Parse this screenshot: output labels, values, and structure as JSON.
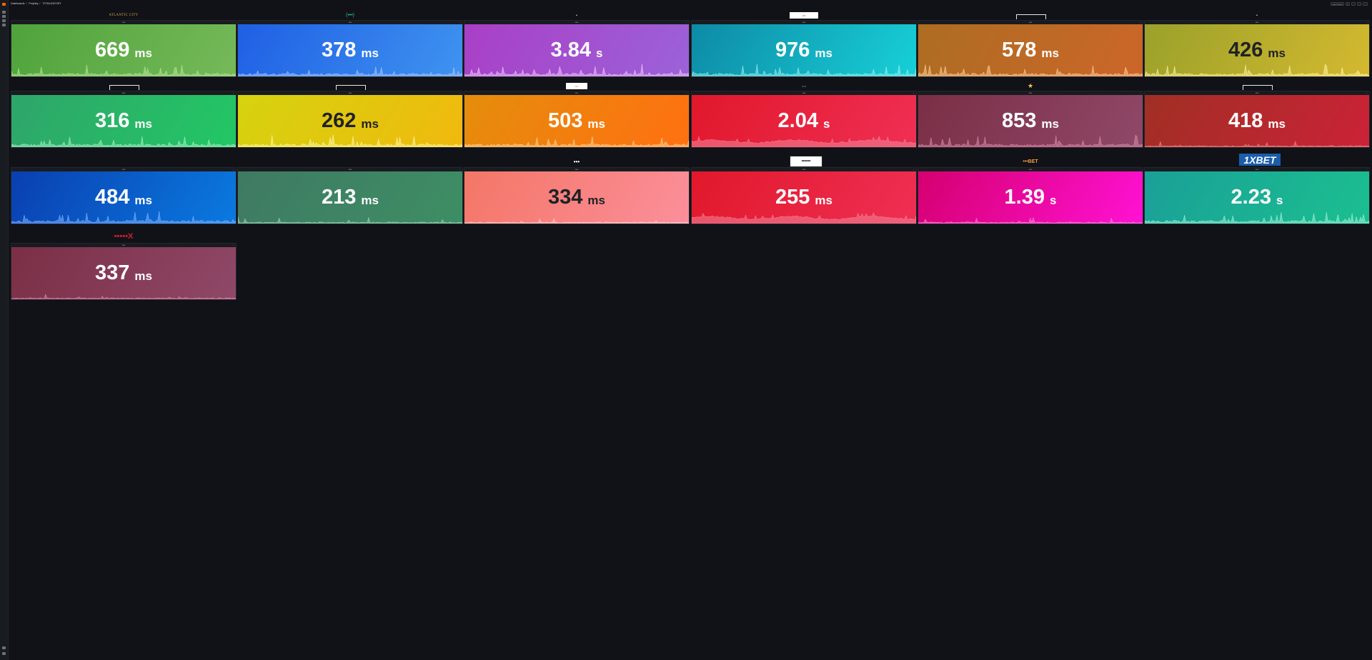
{
  "header": {
    "breadcrumb": [
      "Dashboards",
      "Projekty",
      "TOTALIZATORY"
    ],
    "time_picker": "Last 6 hours",
    "controls": [
      "↺",
      "−",
      "⬚",
      "⋮"
    ]
  },
  "sidebar": {
    "icons": [
      "grafana-logo-icon",
      "search-icon",
      "starred-icon",
      "dashboards-icon",
      "explore-icon",
      "alerting-icon",
      "help-icon"
    ]
  },
  "panels": [
    {
      "logo": "ATLANTIC CITY",
      "logo_style": "l-gold",
      "title": "•••••",
      "value": "669",
      "unit": "ms",
      "gradient": [
        "#4fa33b",
        "#76b95a"
      ],
      "text_theme": "light",
      "spark_color": "#b7e59a",
      "spark_type": "spiky"
    },
    {
      "logo": "(•••)",
      "logo_style": "l-hw",
      "title": "•••••",
      "value": "378",
      "unit": "ms",
      "gradient": [
        "#1f5fe4",
        "#3f93f0"
      ],
      "text_theme": "light",
      "spark_color": "#a8c8ff",
      "spark_type": "spiky"
    },
    {
      "logo": "•",
      "logo_style": "l-dot",
      "title": "•••••",
      "value": "3.84",
      "unit": "s",
      "gradient": [
        "#a93fc6",
        "#9b62d8"
      ],
      "text_theme": "light",
      "spark_color": "#f0c6ff",
      "spark_type": "spiky"
    },
    {
      "logo": "••••",
      "logo_style": "l-whitebox",
      "title": "•••••",
      "value": "976",
      "unit": "ms",
      "gradient": [
        "#0e8aa6",
        "#17d0d7"
      ],
      "text_theme": "light",
      "spark_color": "#9beeed",
      "spark_type": "spiky"
    },
    {
      "logo": "",
      "logo_style": "l-bracket",
      "title": "•••••",
      "value": "578",
      "unit": "ms",
      "gradient": [
        "#ad6d22",
        "#cc6629"
      ],
      "text_theme": "light",
      "spark_color": "#ffd09a",
      "spark_type": "spiky"
    },
    {
      "logo": "•",
      "logo_style": "l-dot",
      "title": "•••••",
      "value": "426",
      "unit": "ms",
      "gradient": [
        "#9aa12a",
        "#d5b930"
      ],
      "text_theme": "dark",
      "spark_color": "#fff4a0",
      "spark_type": "spiky"
    },
    {
      "logo": "",
      "logo_style": "l-bracket",
      "title": "•••••",
      "value": "316",
      "unit": "ms",
      "gradient": [
        "#2fa56a",
        "#22c764"
      ],
      "text_theme": "light",
      "spark_color": "#a6f0c6",
      "spark_type": "spiky"
    },
    {
      "logo": "",
      "logo_style": "l-bracket",
      "title": "•••••",
      "value": "262",
      "unit": "ms",
      "gradient": [
        "#d5d30f",
        "#f0b90e"
      ],
      "text_theme": "dark",
      "spark_color": "#fff7a0",
      "spark_type": "spiky"
    },
    {
      "logo": "••••",
      "logo_style": "l-orangebox",
      "title": "•••••",
      "value": "503",
      "unit": "ms",
      "gradient": [
        "#e58d0c",
        "#ff7011"
      ],
      "text_theme": "light",
      "spark_color": "#ffd39a",
      "spark_type": "spiky"
    },
    {
      "logo": "•••••",
      "logo_style": "l-small",
      "title": "•••••",
      "value": "2.04",
      "unit": "s",
      "gradient": [
        "#e1182b",
        "#ef2f54"
      ],
      "text_theme": "light",
      "spark_color": "#f3869a",
      "spark_type": "plateau"
    },
    {
      "logo": "★",
      "logo_style": "l-star",
      "title": "•••••",
      "value": "853",
      "unit": "ms",
      "gradient": [
        "#7b2f46",
        "#8f4868"
      ],
      "text_theme": "light",
      "spark_color": "#d98aa8",
      "spark_type": "spiky"
    },
    {
      "logo": "",
      "logo_style": "l-bracket",
      "title": "•••••",
      "value": "418",
      "unit": "ms",
      "gradient": [
        "#a02f24",
        "#cb2237"
      ],
      "text_theme": "light",
      "spark_color": "#f08a8a",
      "spark_type": "flat"
    },
    {
      "logo": "",
      "logo_style": "l-small",
      "title": "•••••",
      "value": "484",
      "unit": "ms",
      "gradient": [
        "#0a3fb0",
        "#0a7ae0"
      ],
      "text_theme": "light",
      "spark_color": "#7db3ff",
      "spark_type": "spiky"
    },
    {
      "logo": "",
      "logo_style": "l-small",
      "title": "•••••",
      "value": "213",
      "unit": "ms",
      "gradient": [
        "#3f7a63",
        "#3d8e64"
      ],
      "text_theme": "light",
      "spark_color": "#9ed7b9",
      "spark_type": "flat"
    },
    {
      "logo": "•••",
      "logo_style": "l-fire",
      "title": "•••••",
      "value": "334",
      "unit": "ms",
      "gradient": [
        "#f47666",
        "#fb8f9b"
      ],
      "text_theme": "dark",
      "spark_color": "#ffd4d4",
      "spark_type": "flat"
    },
    {
      "logo": "••••••",
      "logo_style": "l-bet",
      "title": "•••••",
      "value": "255",
      "unit": "ms",
      "gradient": [
        "#e1182b",
        "#ef2f54"
      ],
      "text_theme": "light",
      "spark_color": "#f3869a",
      "spark_type": "plateau"
    },
    {
      "logo": "•••BET",
      "logo_style": "l-888",
      "title": "•••••",
      "value": "1.39",
      "unit": "s",
      "gradient": [
        "#d5006f",
        "#ff12d4"
      ],
      "text_theme": "light",
      "spark_color": "#ff8ae0",
      "spark_type": "flat"
    },
    {
      "logo": "1XBET",
      "logo_style": "l-1x",
      "title": "•••••",
      "value": "2.23",
      "unit": "s",
      "gradient": [
        "#1aa097",
        "#1bbf90"
      ],
      "text_theme": "light",
      "spark_color": "#9ff2d8",
      "spark_type": "spiky"
    },
    {
      "logo": "•••••X",
      "logo_style": "l-betx",
      "title": "•••••",
      "value": "337",
      "unit": "ms",
      "gradient": [
        "#7b2f46",
        "#8f4868"
      ],
      "text_theme": "light",
      "spark_color": "#d98aa8",
      "spark_type": "flat"
    }
  ]
}
